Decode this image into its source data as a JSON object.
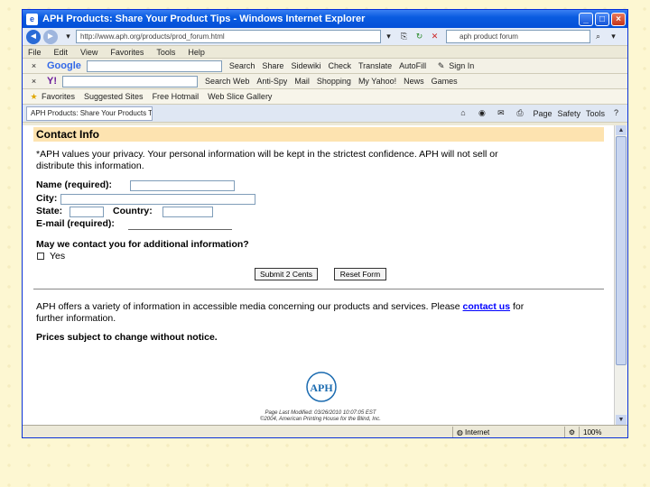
{
  "window": {
    "title": "APH Products: Share Your Product Tips - Windows Internet Explorer",
    "minimize": "_",
    "maximize": "□",
    "close": "×"
  },
  "address_bar": {
    "url": "http://www.aph.org/products/prod_forum.html",
    "search_value": "aph product forum"
  },
  "menu": [
    "File",
    "Edit",
    "View",
    "Favorites",
    "Tools",
    "Help"
  ],
  "google_toolbar": {
    "brand": "Google",
    "items": [
      "Search",
      "Share",
      "Sidewiki",
      "Check",
      "Translate",
      "AutoFill",
      "Sign In"
    ]
  },
  "yahoo_toolbar": {
    "brand": "Y!",
    "items": [
      "Search Web",
      "Anti-Spy",
      "Mail",
      "Shopping",
      "My Yahoo!",
      "News",
      "Games"
    ]
  },
  "favorites_bar": {
    "favorites": "Favorites",
    "items": [
      "Suggested Sites",
      "Free Hotmail",
      "Web Slice Gallery"
    ]
  },
  "tab": {
    "label": "APH Products: Share Your Products Tips"
  },
  "command_bar": [
    "Page",
    "Safety",
    "Tools"
  ],
  "page": {
    "section_title": "Contact Info",
    "privacy_text_1": "*APH values your privacy. Your personal information will be kept in the strictest confidence. APH will not sell or",
    "privacy_text_2": "distribute this information.",
    "name_label": "Name (required):",
    "city_label": "City:",
    "state_label": "State:",
    "country_label": "Country:",
    "email_label": "E-mail (required):",
    "contact_question": "May we contact you for additional information?",
    "yes_label": "Yes",
    "submit_label": "Submit 2 Cents",
    "reset_label": "Reset Form",
    "info_text_1": "APH offers a variety of information in accessible media concerning our products and services. Please",
    "contact_link": "contact us",
    "info_text_2": "for",
    "info_text_3": "further information.",
    "prices_note": "Prices subject to change without notice.",
    "logo_text": "APH",
    "modified": "Page Last Modified: 03/26/2010 10:07:05 EST",
    "copyright": "©2004, American Printing House for the Blind, Inc."
  },
  "status_bar": {
    "zone": "Internet",
    "zoom": "100%"
  },
  "colors": {
    "background": "#fdf7d2",
    "section_header": "#fde3b0",
    "link": "#0000ff",
    "titlebar": "#0a5ce0"
  }
}
